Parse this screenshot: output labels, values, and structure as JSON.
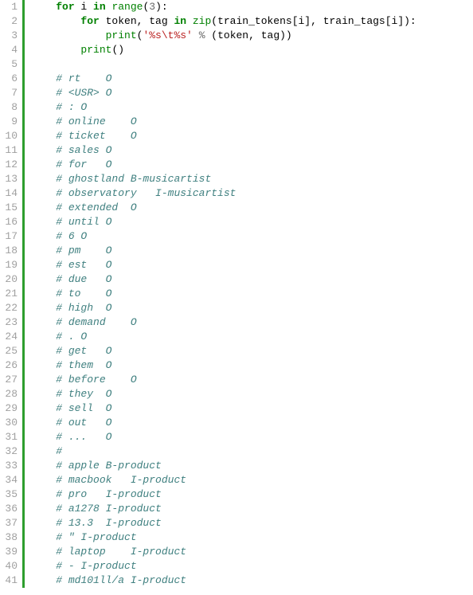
{
  "code": {
    "lines": [
      {
        "n": 1,
        "tokens": [
          {
            "t": "for",
            "c": "kw"
          },
          {
            "t": " i ",
            "c": "name"
          },
          {
            "t": "in",
            "c": "kw"
          },
          {
            "t": " ",
            "c": "name"
          },
          {
            "t": "range",
            "c": "builtin"
          },
          {
            "t": "(",
            "c": "name"
          },
          {
            "t": "3",
            "c": "num"
          },
          {
            "t": "):",
            "c": "name"
          }
        ],
        "indent": 1
      },
      {
        "n": 2,
        "tokens": [
          {
            "t": "for",
            "c": "kw"
          },
          {
            "t": " token, tag ",
            "c": "name"
          },
          {
            "t": "in",
            "c": "kw"
          },
          {
            "t": " ",
            "c": "name"
          },
          {
            "t": "zip",
            "c": "builtin"
          },
          {
            "t": "(train_tokens[i], train_tags[i]):",
            "c": "name"
          }
        ],
        "indent": 2
      },
      {
        "n": 3,
        "tokens": [
          {
            "t": "print",
            "c": "builtin"
          },
          {
            "t": "(",
            "c": "name"
          },
          {
            "t": "'%s\\t%s'",
            "c": "str"
          },
          {
            "t": " ",
            "c": "name"
          },
          {
            "t": "%",
            "c": "op"
          },
          {
            "t": " (token, tag))",
            "c": "name"
          }
        ],
        "indent": 3
      },
      {
        "n": 4,
        "tokens": [
          {
            "t": "print",
            "c": "builtin"
          },
          {
            "t": "()",
            "c": "name"
          }
        ],
        "indent": 2
      },
      {
        "n": 5,
        "tokens": [],
        "indent": 0
      },
      {
        "n": 6,
        "tokens": [
          {
            "t": "# rt    O",
            "c": "comment"
          }
        ],
        "indent": 1
      },
      {
        "n": 7,
        "tokens": [
          {
            "t": "# <USR> O",
            "c": "comment"
          }
        ],
        "indent": 1
      },
      {
        "n": 8,
        "tokens": [
          {
            "t": "# : O",
            "c": "comment"
          }
        ],
        "indent": 1
      },
      {
        "n": 9,
        "tokens": [
          {
            "t": "# online    O",
            "c": "comment"
          }
        ],
        "indent": 1
      },
      {
        "n": 10,
        "tokens": [
          {
            "t": "# ticket    O",
            "c": "comment"
          }
        ],
        "indent": 1
      },
      {
        "n": 11,
        "tokens": [
          {
            "t": "# sales O",
            "c": "comment"
          }
        ],
        "indent": 1
      },
      {
        "n": 12,
        "tokens": [
          {
            "t": "# for   O",
            "c": "comment"
          }
        ],
        "indent": 1
      },
      {
        "n": 13,
        "tokens": [
          {
            "t": "# ghostland B-musicartist",
            "c": "comment"
          }
        ],
        "indent": 1
      },
      {
        "n": 14,
        "tokens": [
          {
            "t": "# observatory   I-musicartist",
            "c": "comment"
          }
        ],
        "indent": 1
      },
      {
        "n": 15,
        "tokens": [
          {
            "t": "# extended  O",
            "c": "comment"
          }
        ],
        "indent": 1
      },
      {
        "n": 16,
        "tokens": [
          {
            "t": "# until O",
            "c": "comment"
          }
        ],
        "indent": 1
      },
      {
        "n": 17,
        "tokens": [
          {
            "t": "# 6 O",
            "c": "comment"
          }
        ],
        "indent": 1
      },
      {
        "n": 18,
        "tokens": [
          {
            "t": "# pm    O",
            "c": "comment"
          }
        ],
        "indent": 1
      },
      {
        "n": 19,
        "tokens": [
          {
            "t": "# est   O",
            "c": "comment"
          }
        ],
        "indent": 1
      },
      {
        "n": 20,
        "tokens": [
          {
            "t": "# due   O",
            "c": "comment"
          }
        ],
        "indent": 1
      },
      {
        "n": 21,
        "tokens": [
          {
            "t": "# to    O",
            "c": "comment"
          }
        ],
        "indent": 1
      },
      {
        "n": 22,
        "tokens": [
          {
            "t": "# high  O",
            "c": "comment"
          }
        ],
        "indent": 1
      },
      {
        "n": 23,
        "tokens": [
          {
            "t": "# demand    O",
            "c": "comment"
          }
        ],
        "indent": 1
      },
      {
        "n": 24,
        "tokens": [
          {
            "t": "# . O",
            "c": "comment"
          }
        ],
        "indent": 1
      },
      {
        "n": 25,
        "tokens": [
          {
            "t": "# get   O",
            "c": "comment"
          }
        ],
        "indent": 1
      },
      {
        "n": 26,
        "tokens": [
          {
            "t": "# them  O",
            "c": "comment"
          }
        ],
        "indent": 1
      },
      {
        "n": 27,
        "tokens": [
          {
            "t": "# before    O",
            "c": "comment"
          }
        ],
        "indent": 1
      },
      {
        "n": 28,
        "tokens": [
          {
            "t": "# they  O",
            "c": "comment"
          }
        ],
        "indent": 1
      },
      {
        "n": 29,
        "tokens": [
          {
            "t": "# sell  O",
            "c": "comment"
          }
        ],
        "indent": 1
      },
      {
        "n": 30,
        "tokens": [
          {
            "t": "# out   O",
            "c": "comment"
          }
        ],
        "indent": 1
      },
      {
        "n": 31,
        "tokens": [
          {
            "t": "# ...   O",
            "c": "comment"
          }
        ],
        "indent": 1
      },
      {
        "n": 32,
        "tokens": [
          {
            "t": "#",
            "c": "comment"
          }
        ],
        "indent": 1
      },
      {
        "n": 33,
        "tokens": [
          {
            "t": "# apple B-product",
            "c": "comment"
          }
        ],
        "indent": 1
      },
      {
        "n": 34,
        "tokens": [
          {
            "t": "# macbook   I-product",
            "c": "comment"
          }
        ],
        "indent": 1
      },
      {
        "n": 35,
        "tokens": [
          {
            "t": "# pro   I-product",
            "c": "comment"
          }
        ],
        "indent": 1
      },
      {
        "n": 36,
        "tokens": [
          {
            "t": "# a1278 I-product",
            "c": "comment"
          }
        ],
        "indent": 1
      },
      {
        "n": 37,
        "tokens": [
          {
            "t": "# 13.3  I-product",
            "c": "comment"
          }
        ],
        "indent": 1
      },
      {
        "n": 38,
        "tokens": [
          {
            "t": "# \" I-product",
            "c": "comment"
          }
        ],
        "indent": 1
      },
      {
        "n": 39,
        "tokens": [
          {
            "t": "# laptop    I-product",
            "c": "comment"
          }
        ],
        "indent": 1
      },
      {
        "n": 40,
        "tokens": [
          {
            "t": "# - I-product",
            "c": "comment"
          }
        ],
        "indent": 1
      },
      {
        "n": 41,
        "tokens": [
          {
            "t": "# md101ll/a I-product",
            "c": "comment"
          }
        ],
        "indent": 1
      }
    ]
  }
}
